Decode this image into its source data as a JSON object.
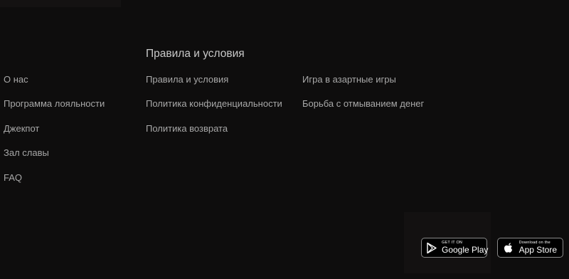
{
  "footer": {
    "section_heading": "Правила и условия",
    "column1": [
      "О нас",
      "Программа лояльности",
      "Джекпот",
      "Зал славы",
      "FAQ"
    ],
    "column2": [
      "Правила и условия",
      "Политика конфиденциальности",
      "Политика возврата"
    ],
    "column3": [
      "Игра в азартные игры",
      "Борьба с отмыванием денег"
    ]
  },
  "stores": {
    "google": {
      "small": "GET IT ON",
      "big": "Google Play",
      "icon": "google-play-icon"
    },
    "apple": {
      "small": "Download on the",
      "big": "App Store",
      "icon": "apple-icon"
    }
  },
  "colors": {
    "background": "#0e0d0d",
    "heading": "#c9c9c9",
    "link": "#a8a8a8"
  }
}
